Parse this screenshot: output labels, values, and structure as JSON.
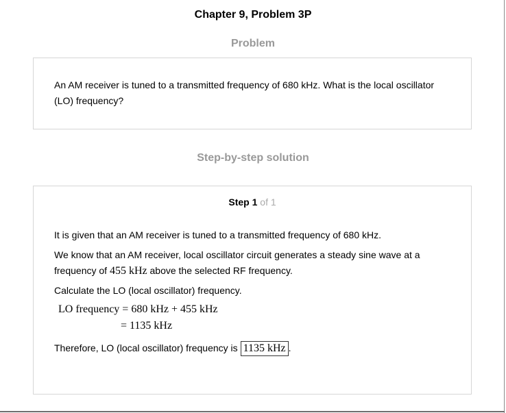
{
  "chapter_title": "Chapter 9, Problem 3P",
  "problem": {
    "heading": "Problem",
    "text": "An AM receiver is tuned to a transmitted frequency of 680 kHz. What is the local oscillator (LO) frequency?"
  },
  "solution": {
    "heading": "Step-by-step solution",
    "step_word": "Step",
    "step_number": "1",
    "step_total": "of 1",
    "given": "It is given that an AM receiver is tuned to a transmitted frequency of 680 kHz.",
    "know_before": "We know that an AM receiver, local oscillator circuit generates a steady sine wave at a frequency of",
    "know_math": "455 kHz",
    "know_after": "above the selected RF frequency.",
    "calculate": "Calculate the LO (local oscillator) frequency.",
    "equation_line1": "LO frequency = 680 kHz + 455 kHz",
    "equation_line2": "= 1135 kHz",
    "conclusion_before": "Therefore, LO (local oscillator) frequency is",
    "answer": "1135 kHz",
    "conclusion_after": "."
  }
}
